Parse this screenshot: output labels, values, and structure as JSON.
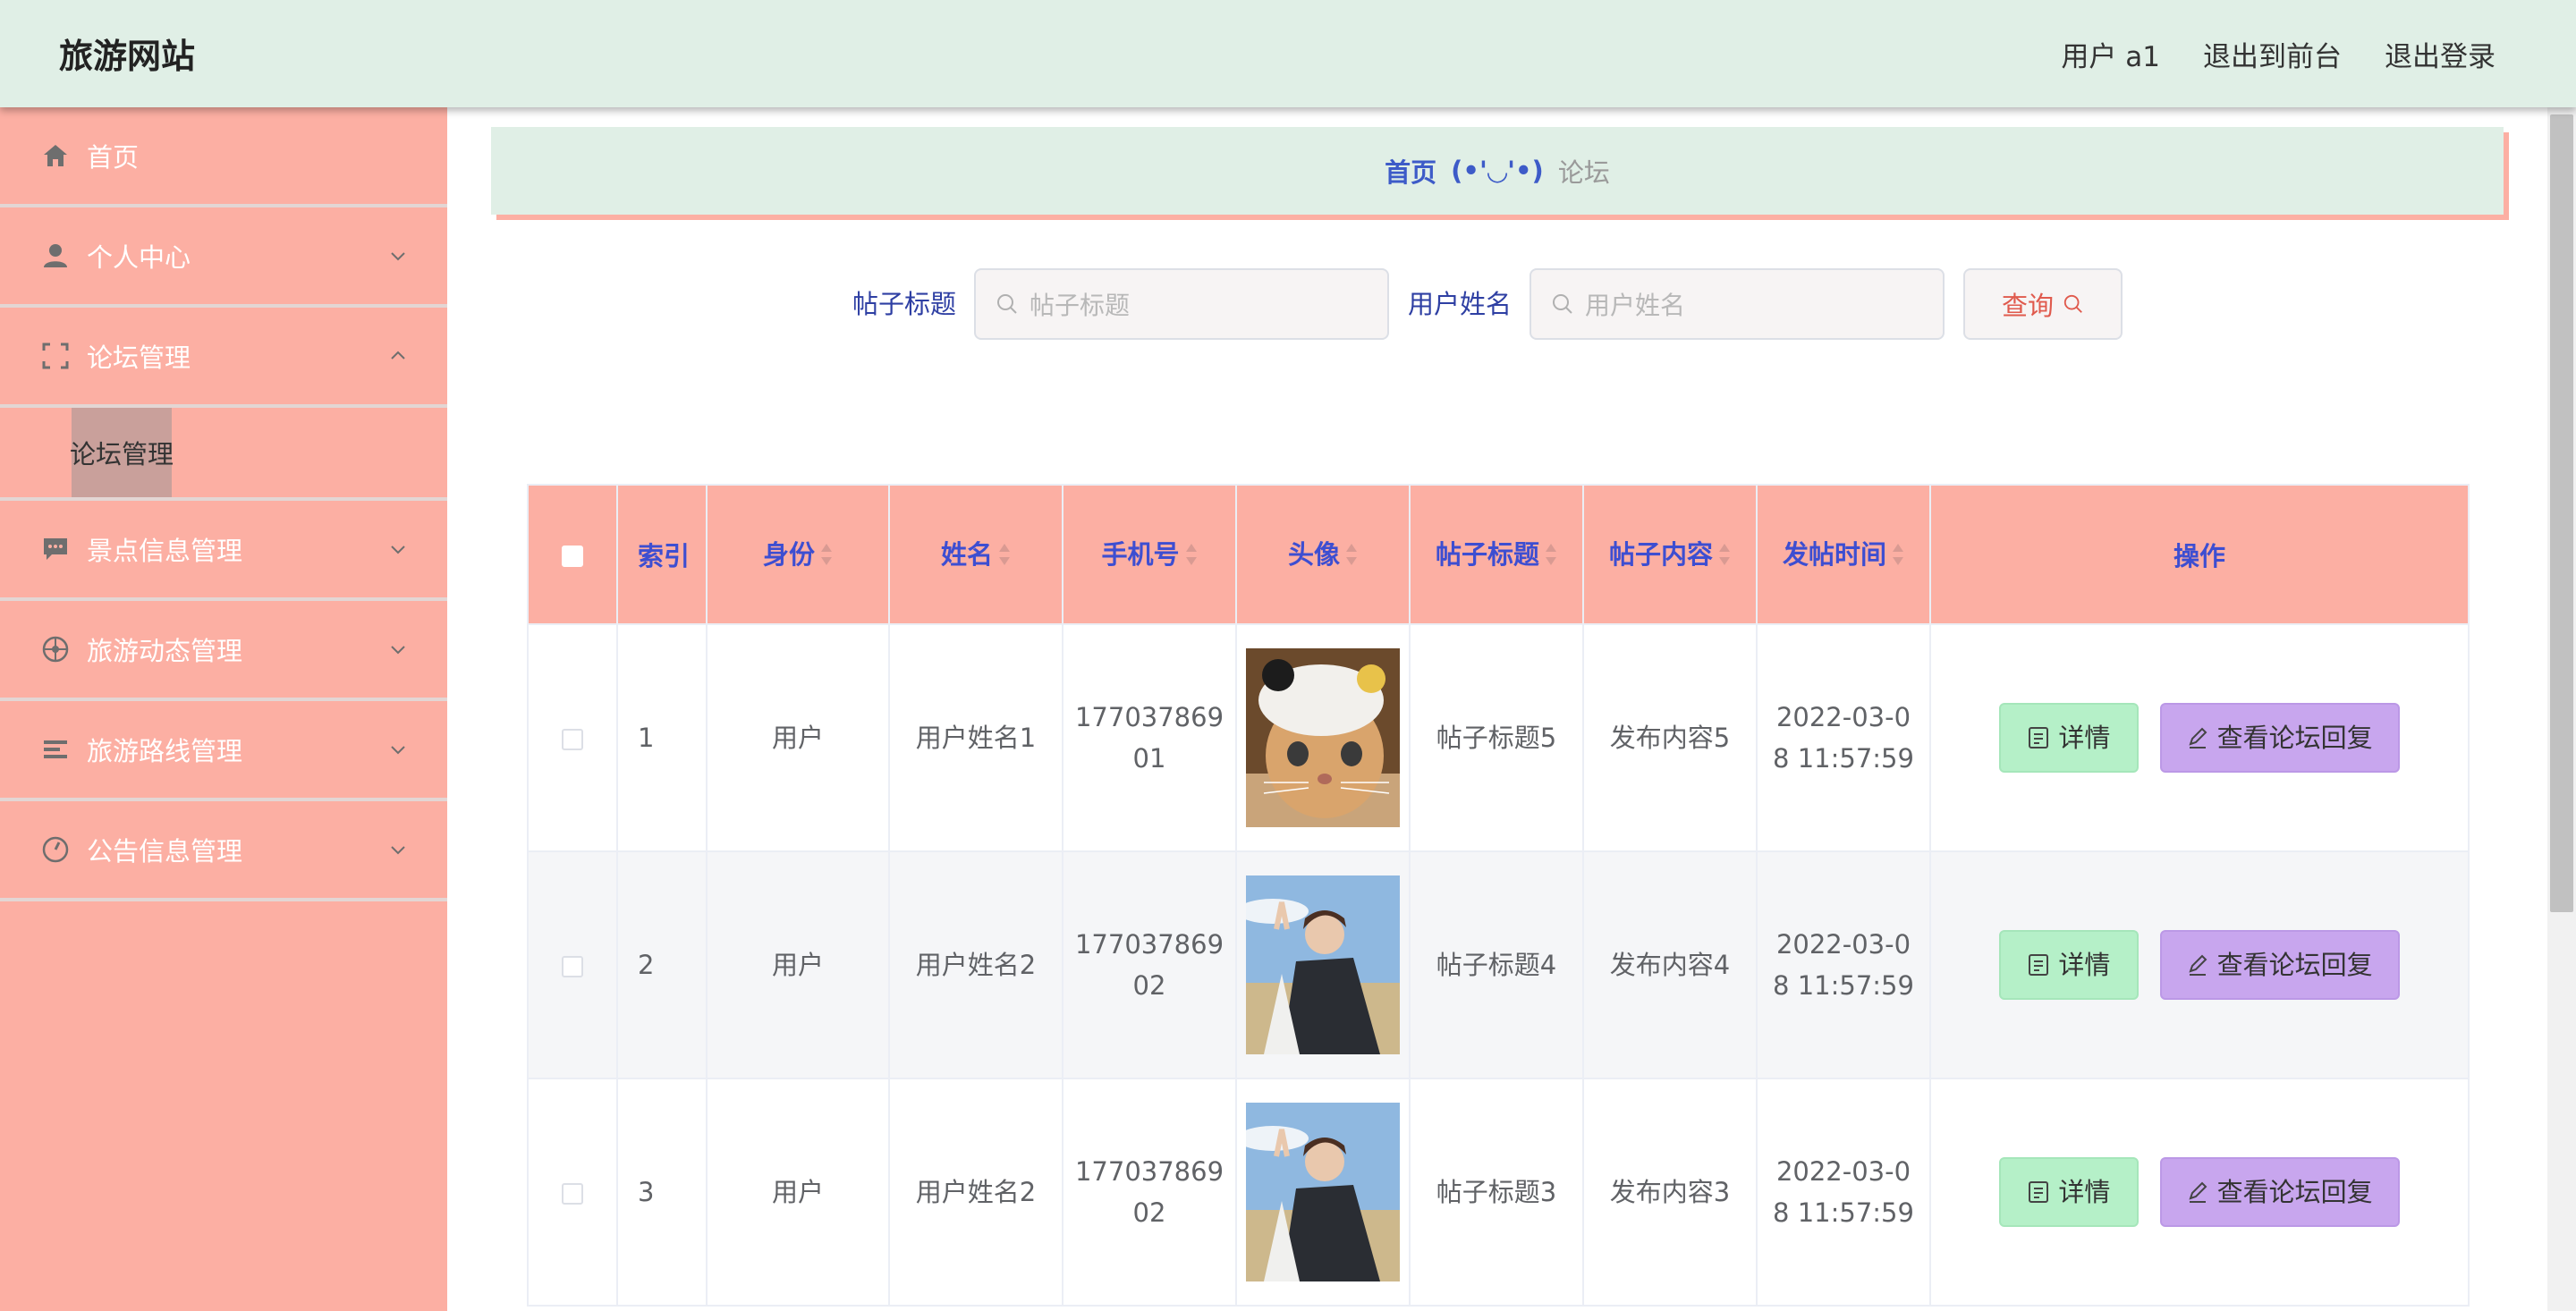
{
  "header": {
    "brand": "旅游网站",
    "user_label": "用户 a1",
    "to_front_label": "退出到前台",
    "logout_label": "退出登录"
  },
  "sidebar": {
    "items": [
      {
        "label": "首页",
        "icon": "home-icon"
      },
      {
        "label": "个人中心",
        "icon": "user-icon",
        "expanded": false
      },
      {
        "label": "论坛管理",
        "icon": "frame-icon",
        "expanded": true
      },
      {
        "label": "景点信息管理",
        "icon": "chat-icon",
        "expanded": false
      },
      {
        "label": "旅游动态管理",
        "icon": "compass-icon",
        "expanded": false
      },
      {
        "label": "旅游路线管理",
        "icon": "list-icon",
        "expanded": false
      },
      {
        "label": "公告信息管理",
        "icon": "clock-icon",
        "expanded": false
      }
    ],
    "submenu": {
      "label": "论坛管理"
    }
  },
  "breadcrumb": {
    "home": "首页",
    "face": "(•'◡'•)",
    "current": "论坛"
  },
  "search": {
    "title_label": "帖子标题",
    "title_placeholder": "帖子标题",
    "title_value": "",
    "name_label": "用户姓名",
    "name_placeholder": "用户姓名",
    "name_value": "",
    "query_label": "查询"
  },
  "table": {
    "columns": [
      "索引",
      "身份",
      "姓名",
      "手机号",
      "头像",
      "帖子标题",
      "帖子内容",
      "发帖时间",
      "操作"
    ],
    "rows": [
      {
        "index": "1",
        "role": "用户",
        "name": "用户姓名1",
        "phone_a": "177037869",
        "phone_b": "01",
        "avatar": "cat-photo",
        "title": "帖子标题5",
        "content": "发布内容5",
        "time_a": "2022-03-0",
        "time_b": "8 11:57:59"
      },
      {
        "index": "2",
        "role": "用户",
        "name": "用户姓名2",
        "phone_a": "177037869",
        "phone_b": "02",
        "avatar": "person-photo",
        "title": "帖子标题4",
        "content": "发布内容4",
        "time_a": "2022-03-0",
        "time_b": "8 11:57:59"
      },
      {
        "index": "3",
        "role": "用户",
        "name": "用户姓名2",
        "phone_a": "177037869",
        "phone_b": "02",
        "avatar": "person-photo",
        "title": "帖子标题3",
        "content": "发布内容3",
        "time_a": "2022-03-0",
        "time_b": "8 11:57:59"
      }
    ],
    "detail_label": "详情",
    "reply_label": "查看论坛回复"
  },
  "colors": {
    "header_bg": "#e0efe6",
    "sidebar_bg": "#fcafa3",
    "accent_blue": "#3d4ed1",
    "detail_btn": "#b5f0c8",
    "reply_btn": "#c8a6ee"
  }
}
